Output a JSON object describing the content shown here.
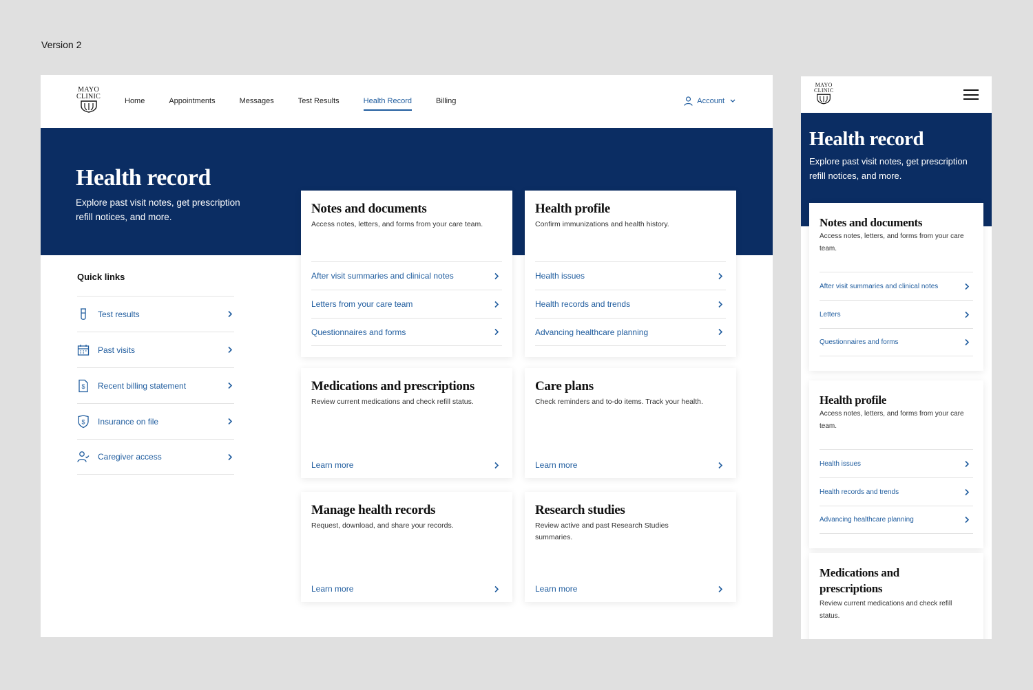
{
  "version_label": "Version 2",
  "logo": {
    "line1": "MAYO",
    "line2": "CLINIC"
  },
  "nav": {
    "items": [
      {
        "label": "Home"
      },
      {
        "label": "Appointments"
      },
      {
        "label": "Messages"
      },
      {
        "label": "Test Results"
      },
      {
        "label": "Health Record"
      },
      {
        "label": "Billing"
      }
    ],
    "active": "Health Record",
    "account_label": "Account"
  },
  "hero": {
    "title": "Health record",
    "subtitle": "Explore past visit notes, get prescription refill notices, and more."
  },
  "quick_links": {
    "title": "Quick links",
    "items": [
      {
        "label": "Test results",
        "icon": "test-tube-icon"
      },
      {
        "label": "Past visits",
        "icon": "calendar-icon"
      },
      {
        "label": "Recent billing statement",
        "icon": "billing-document-icon"
      },
      {
        "label": "Insurance on file",
        "icon": "shield-dollar-icon"
      },
      {
        "label": "Caregiver access",
        "icon": "caregiver-person-icon"
      }
    ]
  },
  "cards": {
    "notes": {
      "title": "Notes and documents",
      "desc": "Access notes, letters, and forms from your care team.",
      "links": [
        "After visit summaries and clinical notes",
        "Letters from your care team",
        "Questionnaires and forms"
      ]
    },
    "profile": {
      "title": "Health profile",
      "desc": "Confirm immunizations and health history.",
      "links": [
        "Health issues",
        "Health records and trends",
        "Advancing healthcare planning"
      ]
    },
    "meds": {
      "title": "Medications and prescriptions",
      "desc": "Review current medications and check refill status.",
      "learn": "Learn more"
    },
    "care": {
      "title": "Care plans",
      "desc": "Check reminders and to-do items. Track your health.",
      "learn": "Learn more"
    },
    "manage": {
      "title": "Manage health records",
      "desc": "Request, download, and share your records.",
      "learn": "Learn more"
    },
    "research": {
      "title": "Research studies",
      "desc": "Review active and past Research Studies summaries.",
      "learn": "Learn more"
    }
  },
  "mobile": {
    "title": "Health record",
    "subtitle": "Explore past visit notes, get prescription refill notices, and more.",
    "notes": {
      "title": "Notes and documents",
      "desc": "Access notes, letters, and forms from your care team.",
      "links": [
        "After visit summaries and clinical notes",
        "Letters",
        "Questionnaires and forms"
      ]
    },
    "profile": {
      "title": "Health profile",
      "desc": "Access notes, letters, and forms from your care team.",
      "links": [
        "Health issues",
        "Health records and trends",
        "Advancing healthcare planning"
      ]
    },
    "meds": {
      "title": "Medications and prescriptions",
      "desc": "Review current medications and check refill status."
    }
  },
  "colors": {
    "navy": "#0b2d63",
    "link_blue": "#1f5c9e",
    "page_bg": "#e0e0e0"
  }
}
